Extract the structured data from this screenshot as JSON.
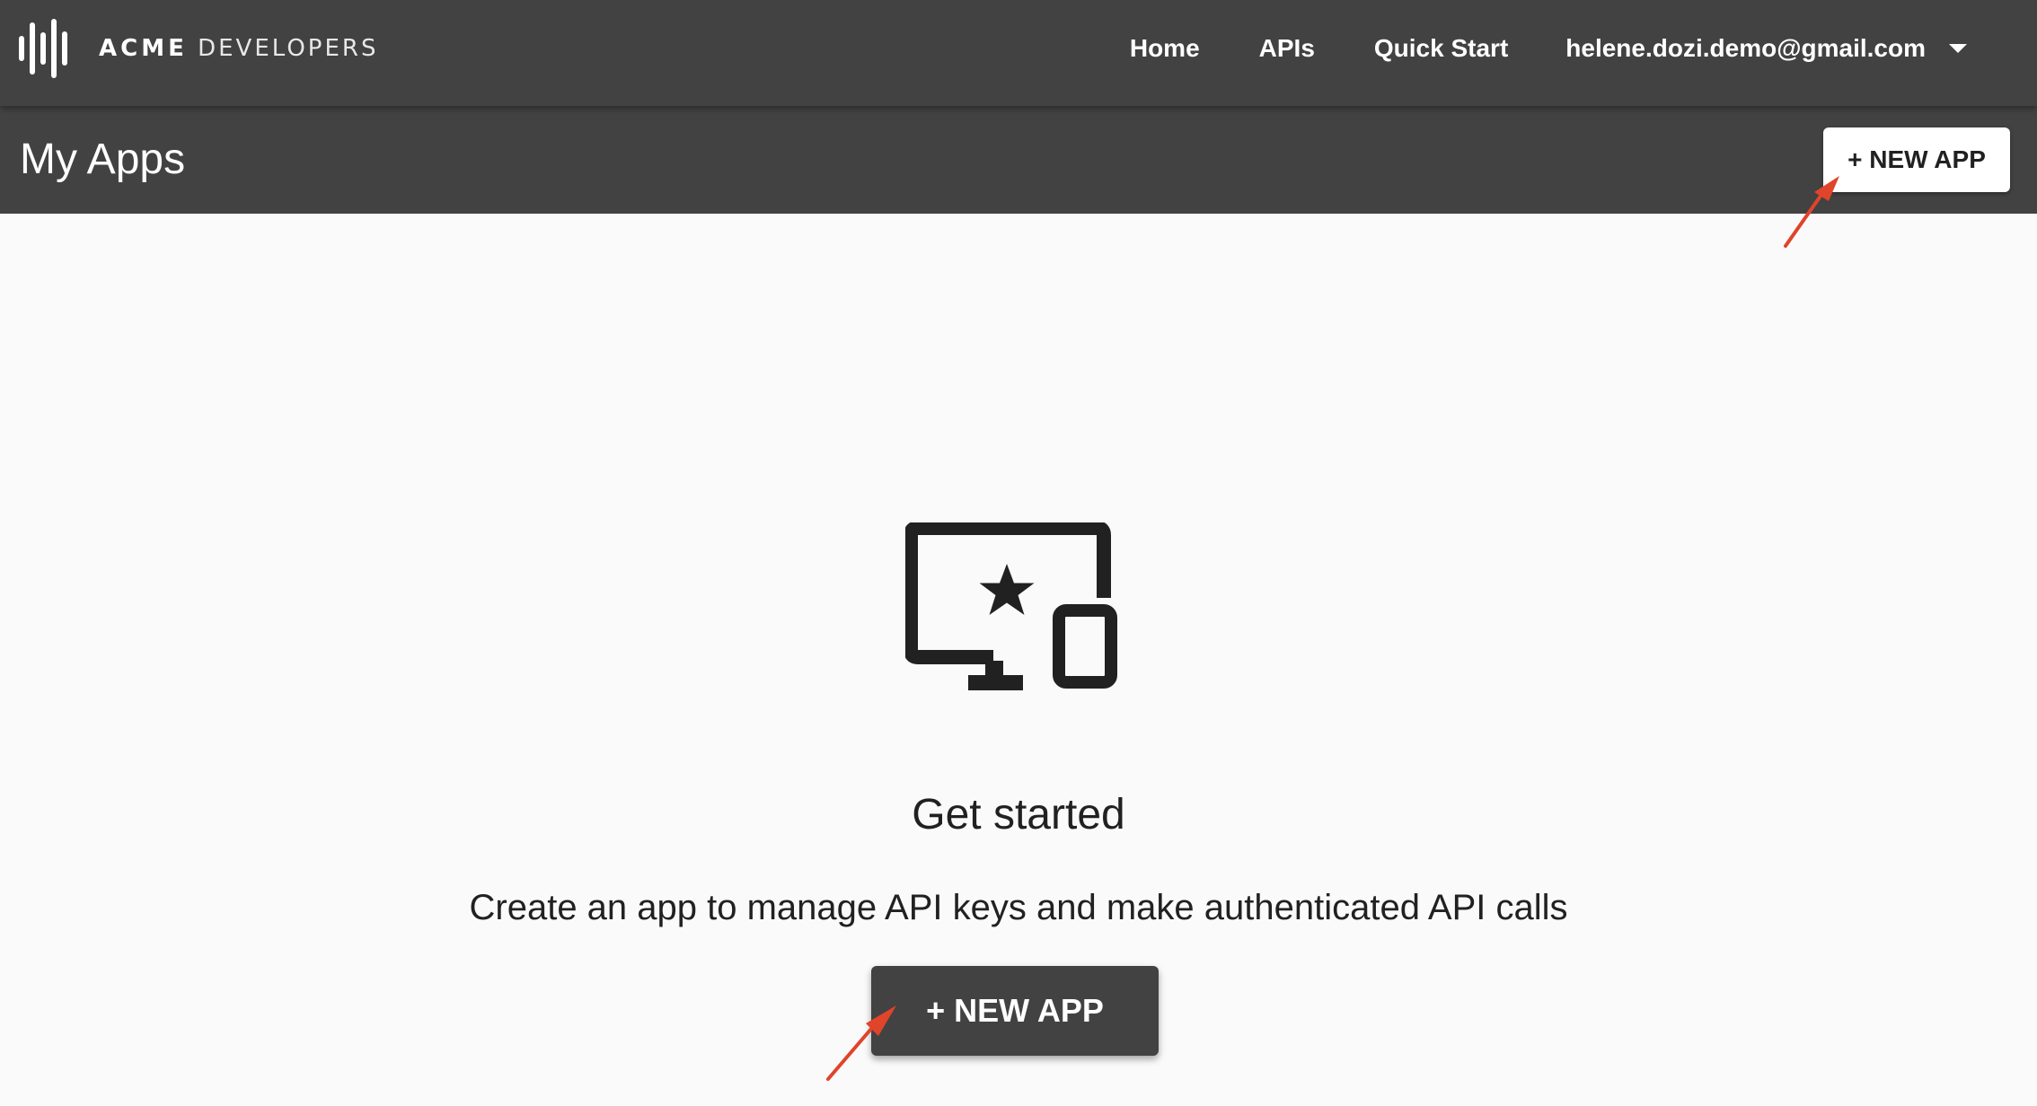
{
  "header": {
    "logo": {
      "brand": "ACME",
      "suffix": "DEVELOPERS",
      "icon": "sound-wave-icon"
    },
    "nav": [
      {
        "label": "Home"
      },
      {
        "label": "APIs"
      },
      {
        "label": "Quick Start"
      }
    ],
    "user": {
      "email": "helene.dozi.demo@gmail.com",
      "icon": "chevron-down-icon"
    }
  },
  "subheader": {
    "title": "My Apps",
    "new_app_label": "+ NEW APP"
  },
  "empty_state": {
    "icon": "devices-star-icon",
    "heading": "Get started",
    "description": "Create an app to manage API keys and make authenticated API calls",
    "button_label": "+ NEW APP"
  },
  "colors": {
    "header_bg": "#424242",
    "page_bg": "#fafafa",
    "annotation_arrow": "#e0442a"
  }
}
